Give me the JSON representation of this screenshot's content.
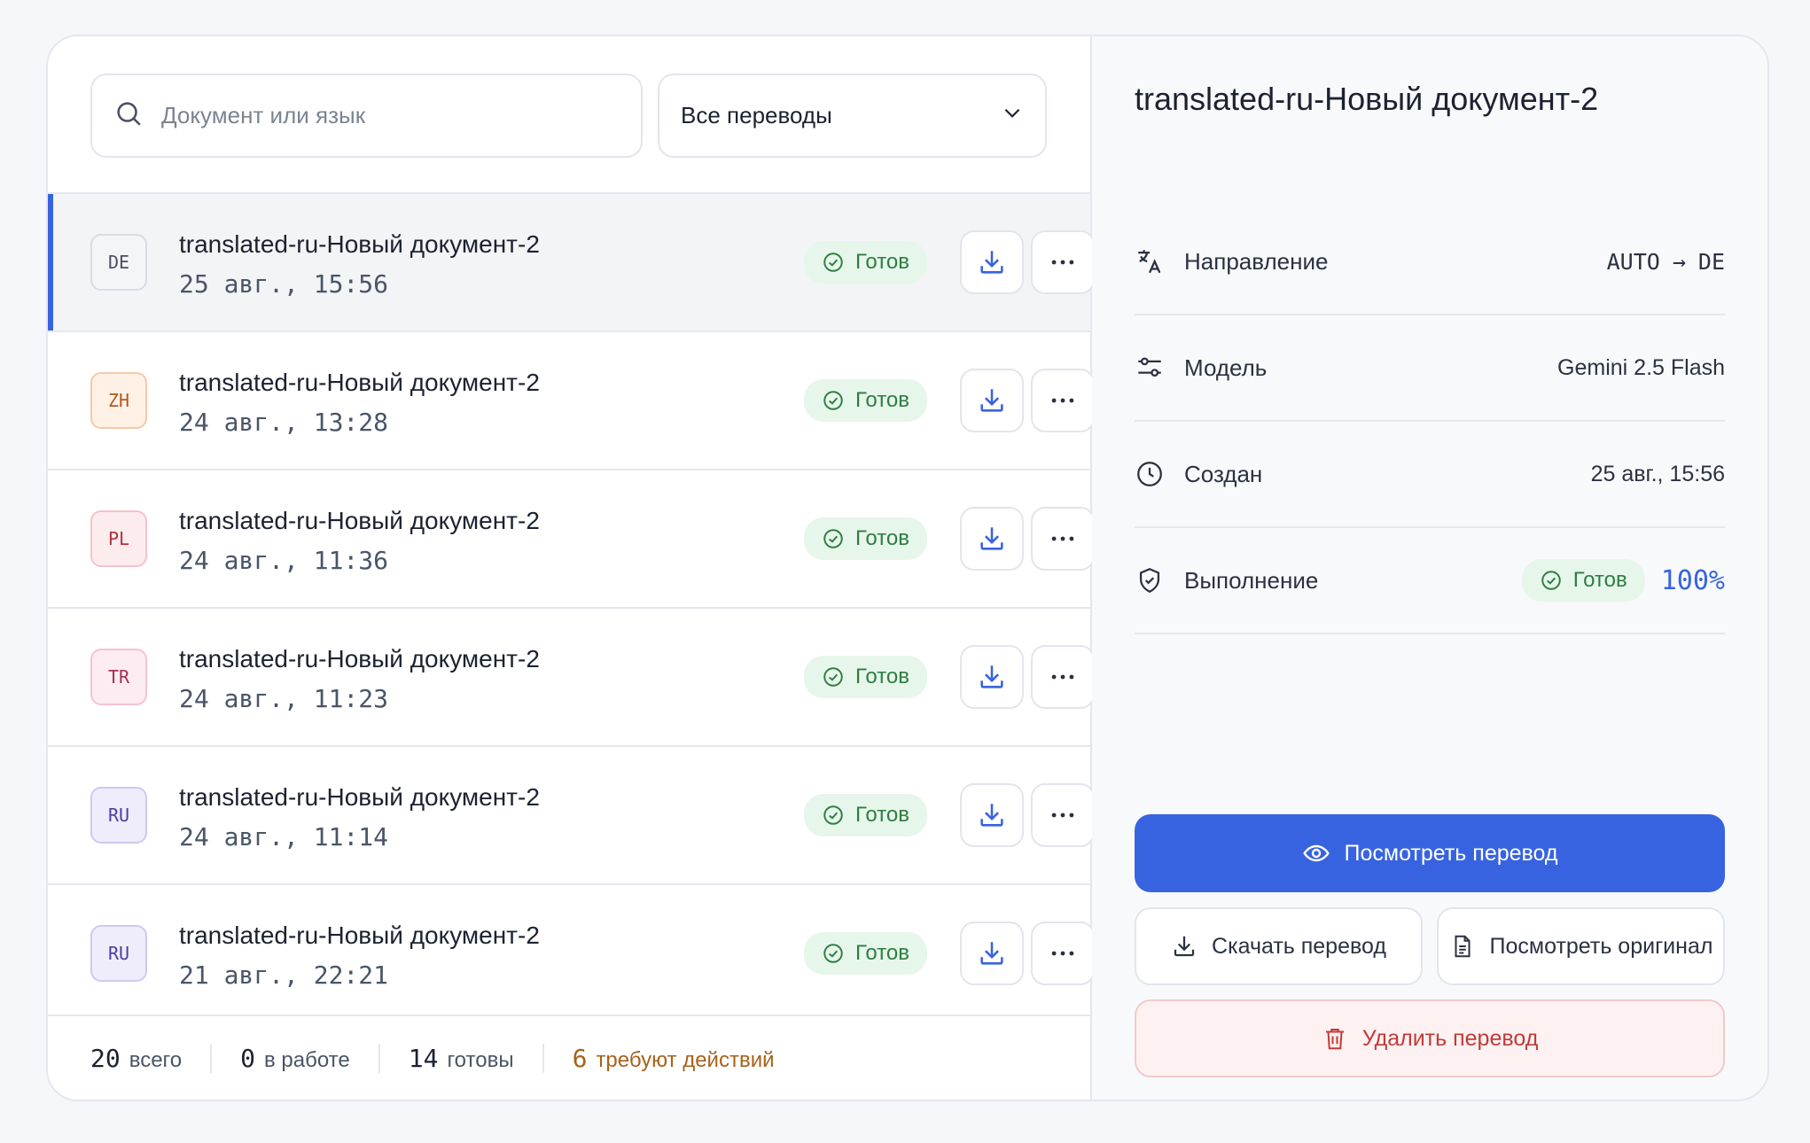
{
  "search": {
    "placeholder": "Документ или язык"
  },
  "filter": {
    "selected": "Все переводы"
  },
  "list": [
    {
      "lang": "DE",
      "title": "translated-ru-Новый документ-2",
      "date": "25 авг., 15:56",
      "status": "Готов",
      "active": true
    },
    {
      "lang": "ZH",
      "title": "translated-ru-Новый документ-2",
      "date": "24 авг., 13:28",
      "status": "Готов"
    },
    {
      "lang": "PL",
      "title": "translated-ru-Новый документ-2",
      "date": "24 авг., 11:36",
      "status": "Готов"
    },
    {
      "lang": "TR",
      "title": "translated-ru-Новый документ-2",
      "date": "24 авг., 11:23",
      "status": "Готов"
    },
    {
      "lang": "RU",
      "title": "translated-ru-Новый документ-2",
      "date": "24 авг., 11:14",
      "status": "Готов"
    },
    {
      "lang": "RU",
      "title": "translated-ru-Новый документ-2",
      "date": "21 авг., 22:21",
      "status": "Готов"
    }
  ],
  "footer": {
    "total_num": "20",
    "total_label": "всего",
    "work_num": "0",
    "work_label": "в работе",
    "ready_num": "14",
    "ready_label": "готовы",
    "action_num": "6",
    "action_label": "требуют действий"
  },
  "detail": {
    "title": "translated-ru-Новый документ-2",
    "direction_label": "Направление",
    "direction_from": "AUTO",
    "direction_arrow": "→",
    "direction_to": "DE",
    "model_label": "Модель",
    "model_value": "Gemini 2.5 Flash",
    "created_label": "Создан",
    "created_value": "25 авг., 15:56",
    "progress_label": "Выполнение",
    "progress_status": "Готов",
    "progress_percent": "100%"
  },
  "actions": {
    "view_translation": "Посмотреть перевод",
    "download_translation": "Скачать перевод",
    "view_original": "Посмотреть оригинал",
    "delete_translation": "Удалить перевод"
  },
  "colors": {
    "accent": "#3863e0",
    "success": "#2e7d43",
    "warning": "#a8621a",
    "danger": "#c23a3a"
  }
}
